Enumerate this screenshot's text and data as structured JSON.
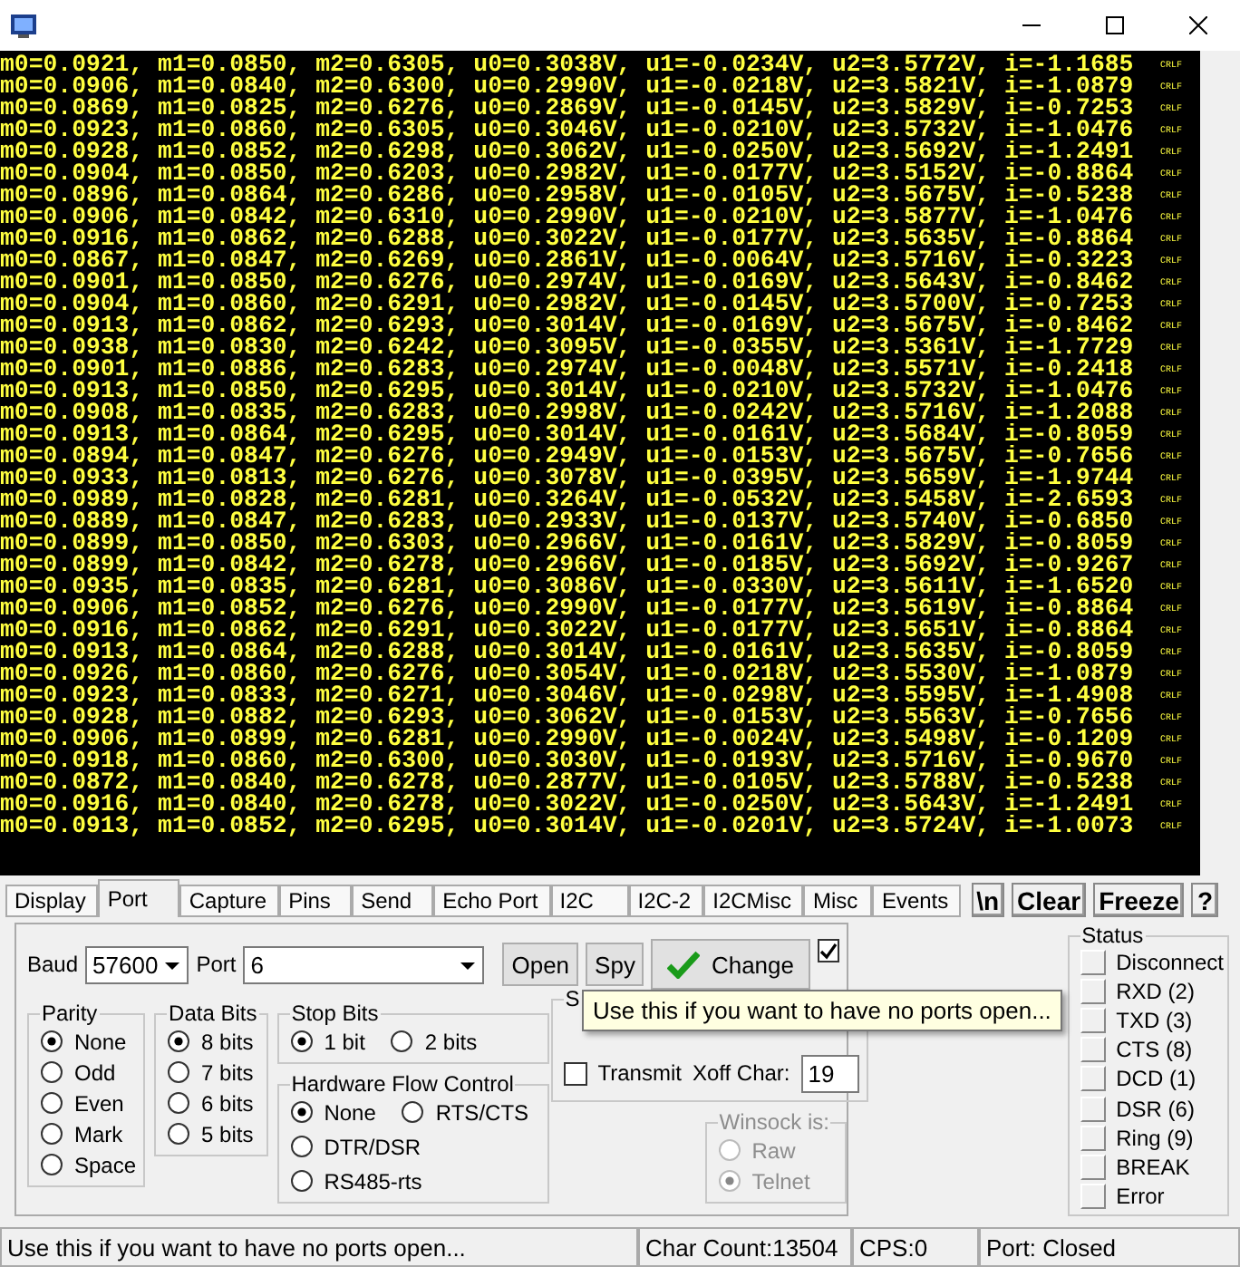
{
  "terminal": {
    "lines": [
      {
        "text": "m0=0.0921, m1=0.0850, m2=0.6305, u0=0.3038V, u1=-0.0234V, u2=3.5772V, i=-1.1685",
        "eol": "CRLF"
      },
      {
        "text": "m0=0.0906, m1=0.0840, m2=0.6300, u0=0.2990V, u1=-0.0218V, u2=3.5821V, i=-1.0879",
        "eol": "CRLF"
      },
      {
        "text": "m0=0.0869, m1=0.0825, m2=0.6276, u0=0.2869V, u1=-0.0145V, u2=3.5829V, i=-0.7253",
        "eol": "CRLF"
      },
      {
        "text": "m0=0.0923, m1=0.0860, m2=0.6305, u0=0.3046V, u1=-0.0210V, u2=3.5732V, i=-1.0476",
        "eol": "CRLF"
      },
      {
        "text": "m0=0.0928, m1=0.0852, m2=0.6298, u0=0.3062V, u1=-0.0250V, u2=3.5692V, i=-1.2491",
        "eol": "CRLF"
      },
      {
        "text": "m0=0.0904, m1=0.0850, m2=0.6203, u0=0.2982V, u1=-0.0177V, u2=3.5152V, i=-0.8864",
        "eol": "CRLF"
      },
      {
        "text": "m0=0.0896, m1=0.0864, m2=0.6286, u0=0.2958V, u1=-0.0105V, u2=3.5675V, i=-0.5238",
        "eol": "CRLF"
      },
      {
        "text": "m0=0.0906, m1=0.0842, m2=0.6310, u0=0.2990V, u1=-0.0210V, u2=3.5877V, i=-1.0476",
        "eol": "CRLF"
      },
      {
        "text": "m0=0.0916, m1=0.0862, m2=0.6288, u0=0.3022V, u1=-0.0177V, u2=3.5635V, i=-0.8864",
        "eol": "CRLF"
      },
      {
        "text": "m0=0.0867, m1=0.0847, m2=0.6269, u0=0.2861V, u1=-0.0064V, u2=3.5716V, i=-0.3223",
        "eol": "CRLF"
      },
      {
        "text": "m0=0.0901, m1=0.0850, m2=0.6276, u0=0.2974V, u1=-0.0169V, u2=3.5643V, i=-0.8462",
        "eol": "CRLF"
      },
      {
        "text": "m0=0.0904, m1=0.0860, m2=0.6291, u0=0.2982V, u1=-0.0145V, u2=3.5700V, i=-0.7253",
        "eol": "CRLF"
      },
      {
        "text": "m0=0.0913, m1=0.0862, m2=0.6293, u0=0.3014V, u1=-0.0169V, u2=3.5675V, i=-0.8462",
        "eol": "CRLF"
      },
      {
        "text": "m0=0.0938, m1=0.0830, m2=0.6242, u0=0.3095V, u1=-0.0355V, u2=3.5361V, i=-1.7729",
        "eol": "CRLF"
      },
      {
        "text": "m0=0.0901, m1=0.0886, m2=0.6283, u0=0.2974V, u1=-0.0048V, u2=3.5571V, i=-0.2418",
        "eol": "CRLF"
      },
      {
        "text": "m0=0.0913, m1=0.0850, m2=0.6295, u0=0.3014V, u1=-0.0210V, u2=3.5732V, i=-1.0476",
        "eol": "CRLF"
      },
      {
        "text": "m0=0.0908, m1=0.0835, m2=0.6283, u0=0.2998V, u1=-0.0242V, u2=3.5716V, i=-1.2088",
        "eol": "CRLF"
      },
      {
        "text": "m0=0.0913, m1=0.0864, m2=0.6295, u0=0.3014V, u1=-0.0161V, u2=3.5684V, i=-0.8059",
        "eol": "CRLF"
      },
      {
        "text": "m0=0.0894, m1=0.0847, m2=0.6276, u0=0.2949V, u1=-0.0153V, u2=3.5675V, i=-0.7656",
        "eol": "CRLF"
      },
      {
        "text": "m0=0.0933, m1=0.0813, m2=0.6276, u0=0.3078V, u1=-0.0395V, u2=3.5659V, i=-1.9744",
        "eol": "CRLF"
      },
      {
        "text": "m0=0.0989, m1=0.0828, m2=0.6281, u0=0.3264V, u1=-0.0532V, u2=3.5458V, i=-2.6593",
        "eol": "CRLF"
      },
      {
        "text": "m0=0.0889, m1=0.0847, m2=0.6283, u0=0.2933V, u1=-0.0137V, u2=3.5740V, i=-0.6850",
        "eol": "CRLF"
      },
      {
        "text": "m0=0.0899, m1=0.0850, m2=0.6303, u0=0.2966V, u1=-0.0161V, u2=3.5829V, i=-0.8059",
        "eol": "CRLF"
      },
      {
        "text": "m0=0.0899, m1=0.0842, m2=0.6278, u0=0.2966V, u1=-0.0185V, u2=3.5692V, i=-0.9267",
        "eol": "CRLF"
      },
      {
        "text": "m0=0.0935, m1=0.0835, m2=0.6281, u0=0.3086V, u1=-0.0330V, u2=3.5611V, i=-1.6520",
        "eol": "CRLF"
      },
      {
        "text": "m0=0.0906, m1=0.0852, m2=0.6276, u0=0.2990V, u1=-0.0177V, u2=3.5619V, i=-0.8864",
        "eol": "CRLF"
      },
      {
        "text": "m0=0.0916, m1=0.0862, m2=0.6291, u0=0.3022V, u1=-0.0177V, u2=3.5651V, i=-0.8864",
        "eol": "CRLF"
      },
      {
        "text": "m0=0.0913, m1=0.0864, m2=0.6288, u0=0.3014V, u1=-0.0161V, u2=3.5635V, i=-0.8059",
        "eol": "CRLF"
      },
      {
        "text": "m0=0.0926, m1=0.0860, m2=0.6276, u0=0.3054V, u1=-0.0218V, u2=3.5530V, i=-1.0879",
        "eol": "CRLF"
      },
      {
        "text": "m0=0.0923, m1=0.0833, m2=0.6271, u0=0.3046V, u1=-0.0298V, u2=3.5595V, i=-1.4908",
        "eol": "CRLF"
      },
      {
        "text": "m0=0.0928, m1=0.0882, m2=0.6293, u0=0.3062V, u1=-0.0153V, u2=3.5563V, i=-0.7656",
        "eol": "CRLF"
      },
      {
        "text": "m0=0.0906, m1=0.0899, m2=0.6281, u0=0.2990V, u1=-0.0024V, u2=3.5498V, i=-0.1209",
        "eol": "CRLF"
      },
      {
        "text": "m0=0.0918, m1=0.0860, m2=0.6300, u0=0.3030V, u1=-0.0193V, u2=3.5716V, i=-0.9670",
        "eol": "CRLF"
      },
      {
        "text": "m0=0.0872, m1=0.0840, m2=0.6278, u0=0.2877V, u1=-0.0105V, u2=3.5788V, i=-0.5238",
        "eol": "CRLF"
      },
      {
        "text": "m0=0.0916, m1=0.0840, m2=0.6278, u0=0.3022V, u1=-0.0250V, u2=3.5643V, i=-1.2491",
        "eol": "CRLF"
      },
      {
        "text": "m0=0.0913, m1=0.0852, m2=0.6295, u0=0.3014V, u1=-0.0201V, u2=3.5724V, i=-1.0073",
        "eol": "CRLF"
      }
    ]
  },
  "tabs": [
    {
      "label": "Display",
      "selected": false
    },
    {
      "label": "Port",
      "selected": true
    },
    {
      "label": "Capture",
      "selected": false
    },
    {
      "label": "Pins",
      "selected": false
    },
    {
      "label": "Send",
      "selected": false
    },
    {
      "label": "Echo Port",
      "selected": false
    },
    {
      "label": "I2C",
      "selected": false
    },
    {
      "label": "I2C-2",
      "selected": false
    },
    {
      "label": "I2CMisc",
      "selected": false
    },
    {
      "label": "Misc",
      "selected": false
    },
    {
      "label": "Events",
      "selected": false
    }
  ],
  "toolbar_buttons": [
    "\\n",
    "Clear",
    "Freeze",
    "?"
  ],
  "port": {
    "baud_label": "Baud",
    "baud": "57600",
    "port_label": "Port",
    "port": "6",
    "open": "Open",
    "spy": "Spy",
    "change": "Change",
    "change_checked": true
  },
  "parity": {
    "title": "Parity",
    "options": [
      {
        "label": "None",
        "selected": true
      },
      {
        "label": "Odd",
        "selected": false
      },
      {
        "label": "Even",
        "selected": false
      },
      {
        "label": "Mark",
        "selected": false
      },
      {
        "label": "Space",
        "selected": false
      }
    ]
  },
  "data_bits": {
    "title": "Data Bits",
    "options": [
      {
        "label": "8 bits",
        "selected": true
      },
      {
        "label": "7 bits",
        "selected": false
      },
      {
        "label": "6 bits",
        "selected": false
      },
      {
        "label": "5 bits",
        "selected": false
      }
    ]
  },
  "stop_bits": {
    "title": "Stop Bits",
    "options": [
      {
        "label": "1 bit",
        "selected": true
      },
      {
        "label": "2 bits",
        "selected": false
      }
    ]
  },
  "flow_control": {
    "title": "Hardware Flow Control",
    "options": [
      {
        "label": "None",
        "selected": true
      },
      {
        "label": "RTS/CTS",
        "selected": false
      },
      {
        "label": "DTR/DSR",
        "selected": false
      },
      {
        "label": "RS485-rts",
        "selected": false
      }
    ]
  },
  "software_flow": {
    "title": "S",
    "transmit_label": "Transmit",
    "transmit_checked": false,
    "xoff_label": "Xoff Char:",
    "xoff": "19"
  },
  "winsock": {
    "title": "Winsock is:",
    "disabled": true,
    "options": [
      {
        "label": "Raw",
        "selected": false
      },
      {
        "label": "Telnet",
        "selected": true
      }
    ]
  },
  "tooltip": "Use this if you want to have no ports open...",
  "status": {
    "title": "Status",
    "items": [
      {
        "label": "Disconnect",
        "on": false
      },
      {
        "label": "RXD (2)",
        "on": false
      },
      {
        "label": "TXD (3)",
        "on": false
      },
      {
        "label": "CTS (8)",
        "on": false
      },
      {
        "label": "DCD (1)",
        "on": false
      },
      {
        "label": "DSR (6)",
        "on": false
      },
      {
        "label": "Ring (9)",
        "on": false
      },
      {
        "label": "BREAK",
        "on": false
      },
      {
        "label": "Error",
        "on": false
      }
    ]
  },
  "status_bar": {
    "message": "Use this if you want to have no ports open...",
    "char_count": "Char Count:13504",
    "cps": "CPS:0",
    "port_state": "Port: Closed"
  }
}
